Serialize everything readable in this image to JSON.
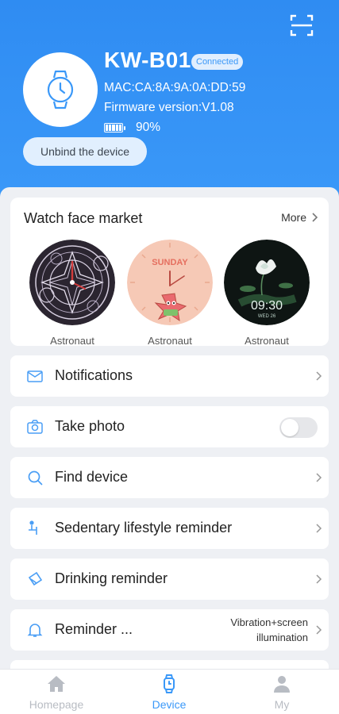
{
  "header": {
    "device_name": "KW-B01",
    "status_badge": "Connected",
    "mac": "MAC:CA:8A:9A:0A:DD:59",
    "firmware": "Firmware version:V1.08",
    "battery": "90%",
    "unbind_label": "Unbind the device"
  },
  "market": {
    "title": "Watch face market",
    "more_label": "More",
    "faces": [
      {
        "label": "Astronaut",
        "icon": "magic-circle-dial"
      },
      {
        "label": "Astronaut",
        "icon": "sunday-starfish-dial",
        "dial_text": "SUNDAY"
      },
      {
        "label": "Astronaut",
        "icon": "lotus-dial",
        "time": "09:30",
        "date": "WED 26"
      }
    ]
  },
  "settings": [
    {
      "label": "Notifications",
      "icon": "message-icon"
    },
    {
      "label": "Take photo",
      "icon": "camera-icon"
    },
    {
      "label": "Find device",
      "icon": "search-icon"
    },
    {
      "label": "Sedentary lifestyle reminder",
      "icon": "sedentary-icon"
    },
    {
      "label": "Drinking reminder",
      "icon": "drink-icon"
    },
    {
      "label": "Reminder ...",
      "icon": "bell-icon",
      "value": "Vibration+screen illumination"
    }
  ],
  "tabs": [
    {
      "label": "Homepage",
      "icon": "home-icon"
    },
    {
      "label": "Device",
      "icon": "watch-icon"
    },
    {
      "label": "My",
      "icon": "person-icon"
    }
  ],
  "colors": {
    "accent": "#3a98f8",
    "background": "#eef0f4"
  }
}
